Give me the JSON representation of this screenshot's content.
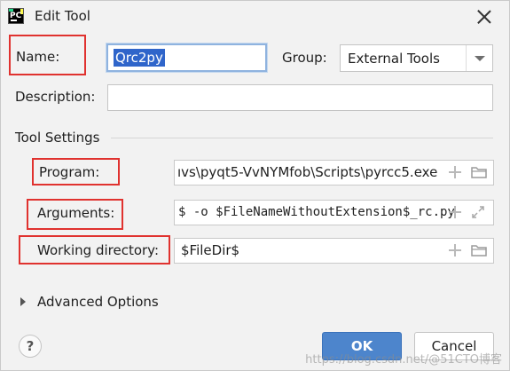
{
  "window": {
    "title": "Edit Tool"
  },
  "name": {
    "label": "Name:",
    "value": "Qrc2py"
  },
  "group": {
    "label": "Group:",
    "value": "External Tools"
  },
  "description": {
    "label": "Description:",
    "value": ""
  },
  "tool_settings": {
    "title": "Tool Settings",
    "program": {
      "label": "Program:",
      "value": "ıvs\\pyqt5-VvNYMfob\\Scripts\\pyrcc5.exe"
    },
    "arguments": {
      "label": "Arguments:",
      "value": "$ -o $FileNameWithoutExtension$_rc.py"
    },
    "working_directory": {
      "label": "Working directory:",
      "value": "$FileDir$"
    }
  },
  "advanced": {
    "label": "Advanced Options"
  },
  "buttons": {
    "help": "?",
    "ok": "OK",
    "cancel": "Cancel"
  },
  "watermark": "https://blog.csdn.net/@51CTO博客",
  "colors": {
    "accent": "#4d85cc",
    "highlight": "#e0322f",
    "selection": "#2f65ca"
  }
}
